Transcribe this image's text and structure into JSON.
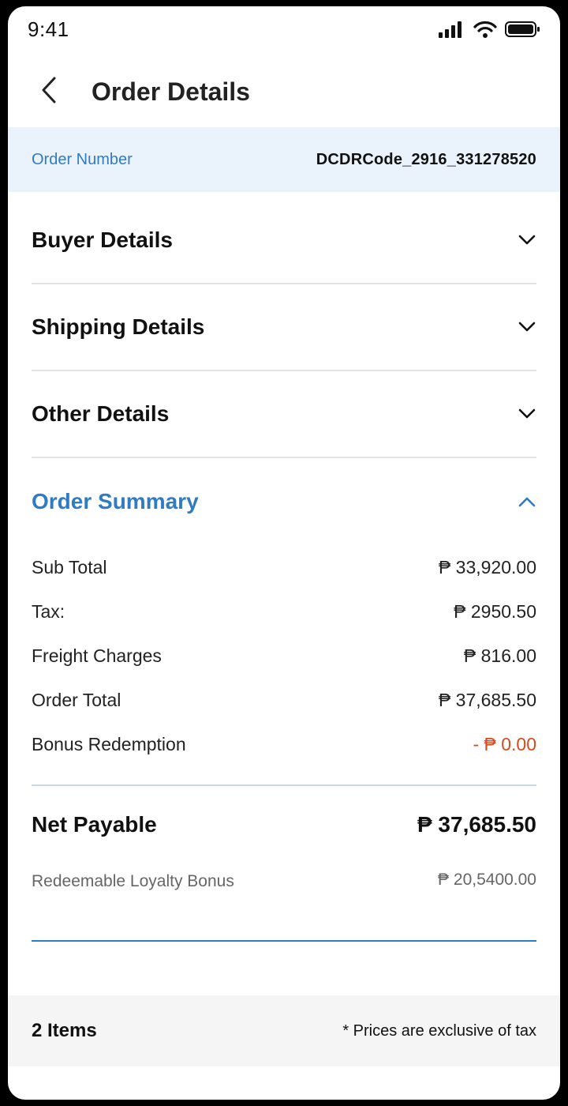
{
  "status_bar": {
    "time": "9:41"
  },
  "header": {
    "title": "Order Details"
  },
  "order": {
    "label": "Order Number",
    "value": "DCDRCode_2916_331278520"
  },
  "sections": {
    "buyer": "Buyer Details",
    "shipping": "Shipping Details",
    "other": "Other Details",
    "summary": "Order Summary"
  },
  "summary": {
    "sub_total": {
      "label": "Sub Total",
      "value": "₱ 33,920.00"
    },
    "tax": {
      "label": "Tax:",
      "value": "₱ 2950.50"
    },
    "freight": {
      "label": "Freight Charges",
      "value": "₱ 816.00"
    },
    "order_total": {
      "label": "Order Total",
      "value": "₱ 37,685.50"
    },
    "bonus": {
      "label": "Bonus Redemption",
      "value": "- ₱ 0.00"
    },
    "net_payable": {
      "label": "Net Payable",
      "value": "₱ 37,685.50"
    },
    "loyalty": {
      "label": "Redeemable Loyalty Bonus",
      "value": "₱ 20,5400.00"
    }
  },
  "footer": {
    "items": "2 Items",
    "note": "* Prices are exclusive of tax"
  },
  "colors": {
    "accent": "#2f7bc4",
    "band": "#eaf3fc",
    "negative": "#d64a1f",
    "footer_bg": "#f5f5f5"
  },
  "icons": [
    "signal-icon",
    "wifi-icon",
    "battery-icon",
    "back-arrow-icon",
    "chevron-down-icon",
    "chevron-up-icon"
  ]
}
